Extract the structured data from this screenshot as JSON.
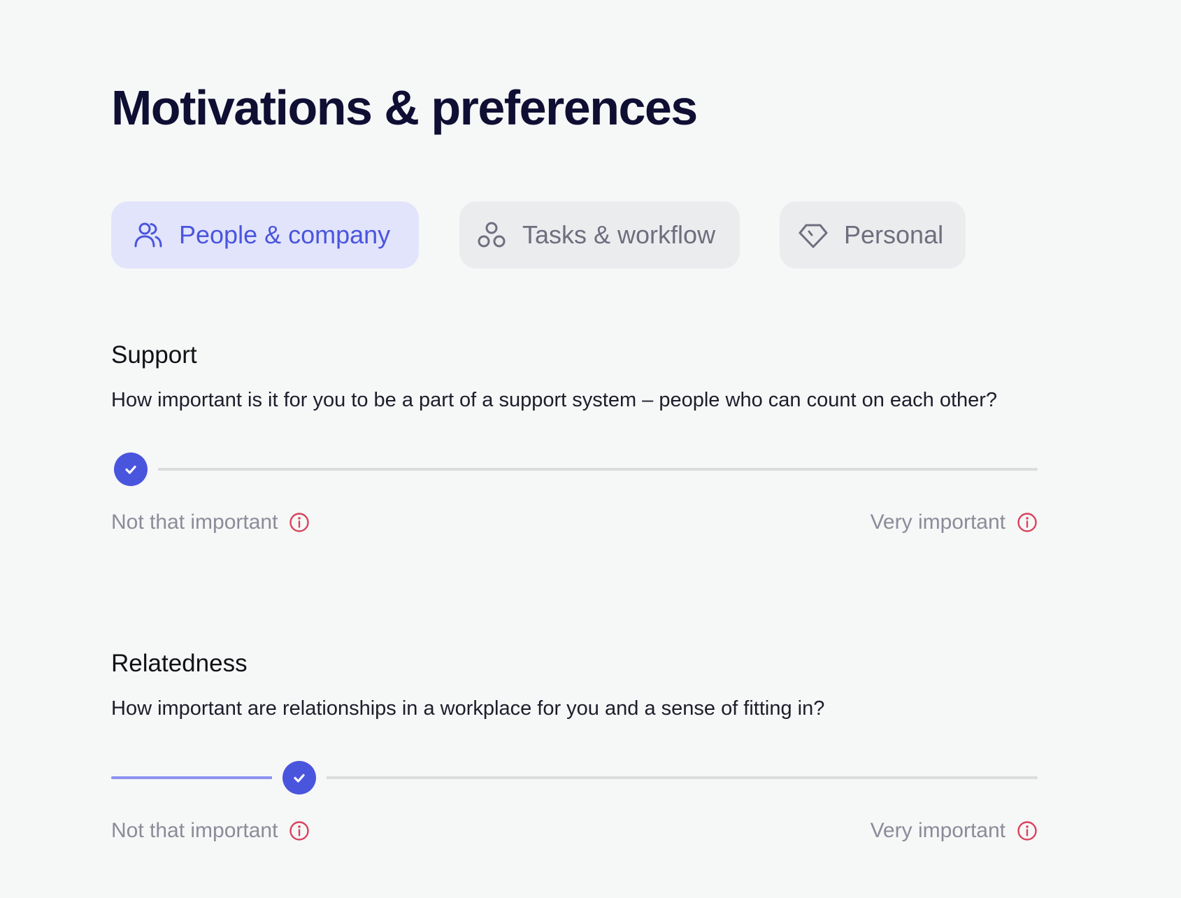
{
  "header": {
    "title": "Motivations & preferences"
  },
  "tabs": [
    {
      "label": "People & company",
      "icon": "people-icon",
      "active": true
    },
    {
      "label": "Tasks & workflow",
      "icon": "circles-icon",
      "active": false
    },
    {
      "label": "Personal",
      "icon": "diamond-icon",
      "active": false
    }
  ],
  "questions": [
    {
      "title": "Support",
      "question": "How important is it for you to be a part of a support system – people who can count on each other?",
      "value": 0,
      "min_label": "Not that important",
      "max_label": "Very important"
    },
    {
      "title": "Relatedness",
      "question": "How important are relationships in a workplace for you and a sense of fitting in?",
      "value": 0.19,
      "min_label": "Not that important",
      "max_label": "Very important"
    }
  ],
  "colors": {
    "accent": "#4a55de",
    "accent_light": "#e2e4fb",
    "info_icon": "#d9435d",
    "title": "#0f0e33"
  }
}
